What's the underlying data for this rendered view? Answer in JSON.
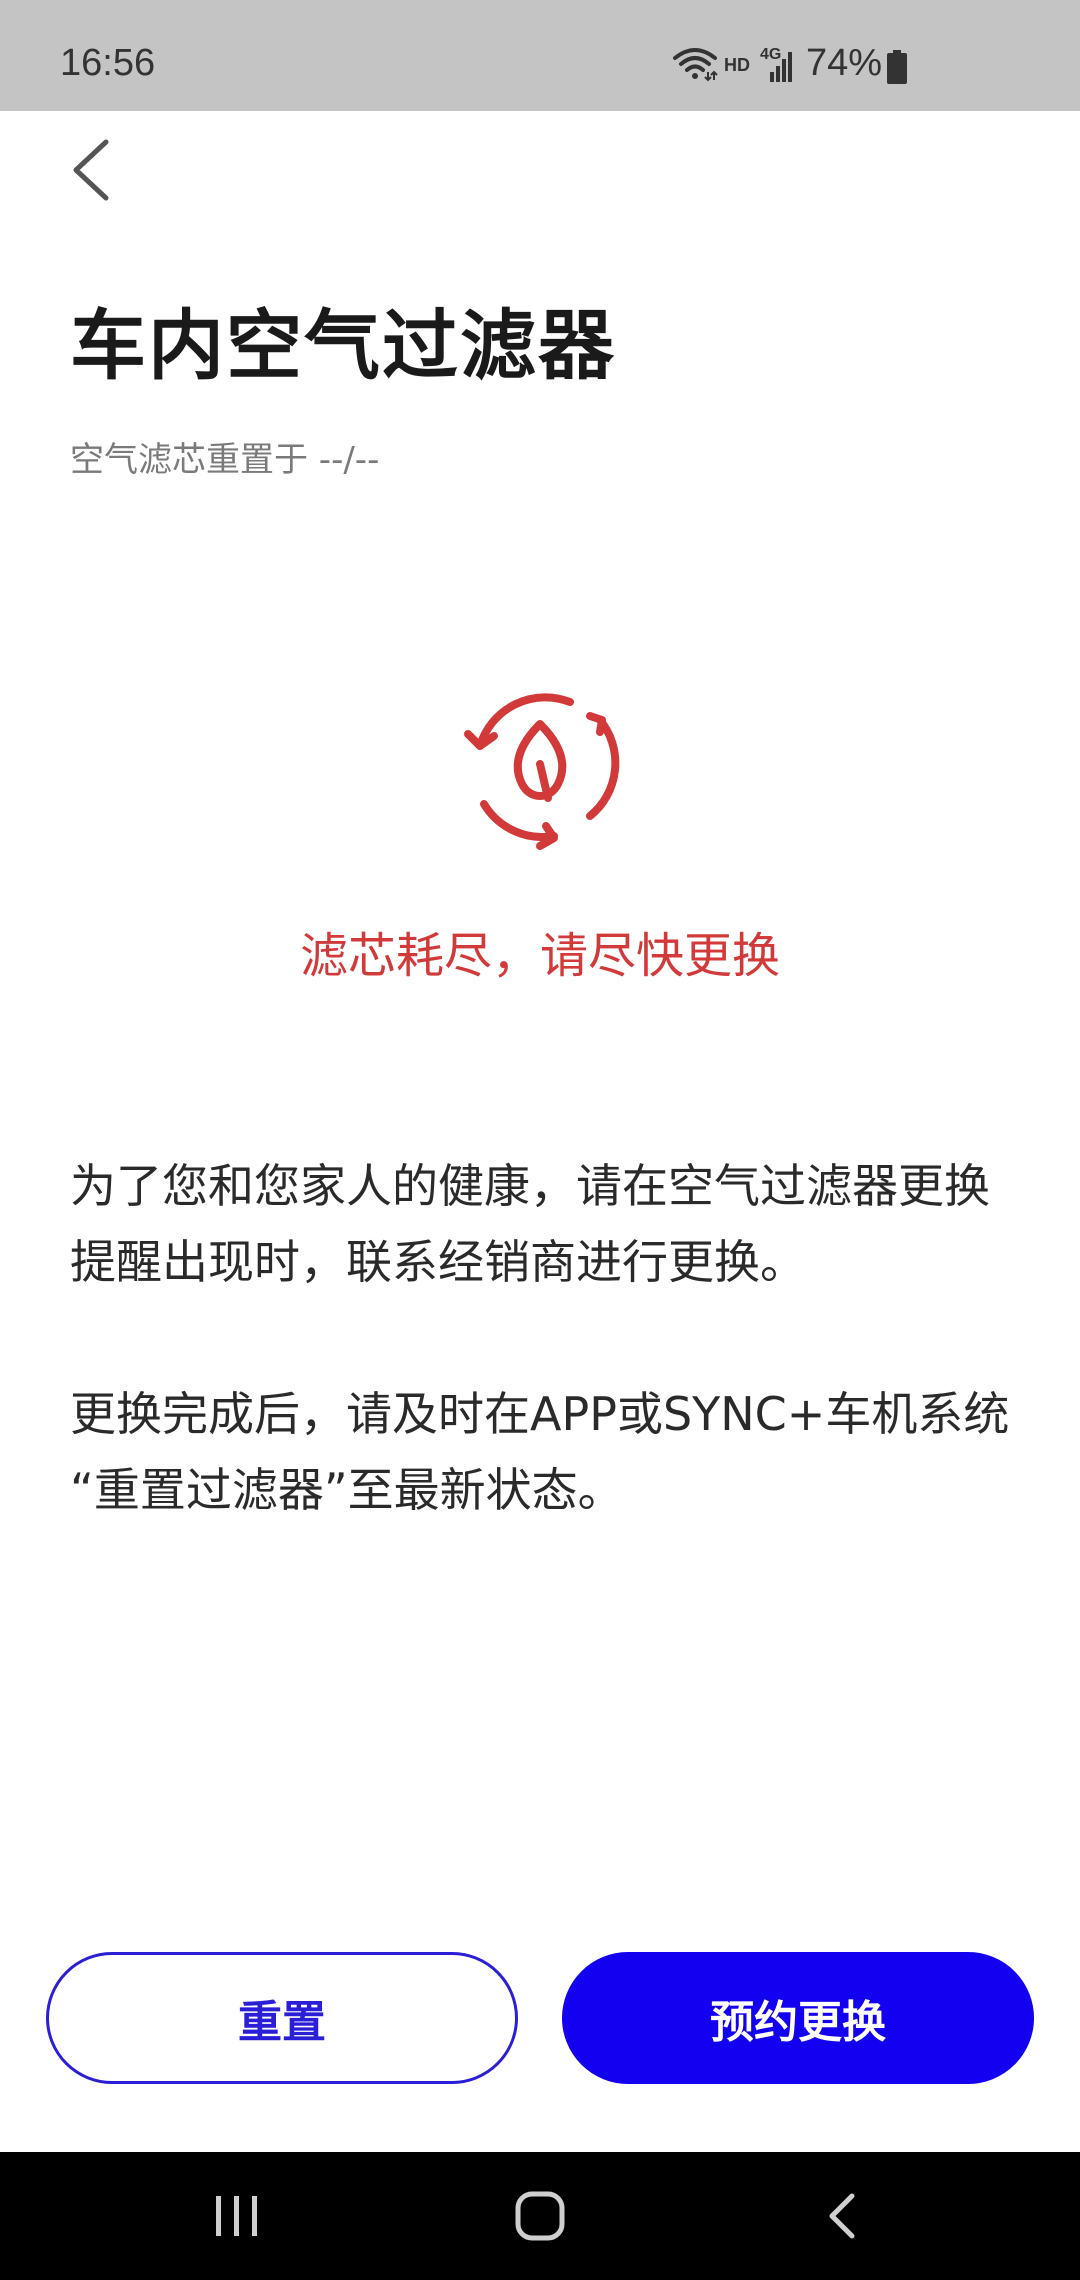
{
  "status_bar": {
    "time": "16:56",
    "hd_label": "HD",
    "network_label": "4G",
    "battery_percent": "74%"
  },
  "header": {
    "back_icon": "chevron-left-icon"
  },
  "page": {
    "title": "车内空气过滤器",
    "subtitle": "空气滤芯重置于 --/--"
  },
  "status": {
    "icon": "filter-cycle-leaf-icon",
    "warning": "滤芯耗尽，请尽快更换",
    "warning_color": "#d23a3a"
  },
  "description": {
    "paragraph_1": "为了您和您家人的健康，请在空气过滤器更换提醒出现时，联系经销商进行更换。",
    "paragraph_2": "更换完成后，请及时在APP或SYNC+车机系统 “重置过滤器”至最新状态。"
  },
  "actions": {
    "reset_label": "重置",
    "book_label": "预约更换",
    "accent_color": "#1400f0"
  },
  "nav_bar": {
    "recent_icon": "recent-apps-icon",
    "home_icon": "home-icon",
    "back_icon": "back-icon"
  }
}
